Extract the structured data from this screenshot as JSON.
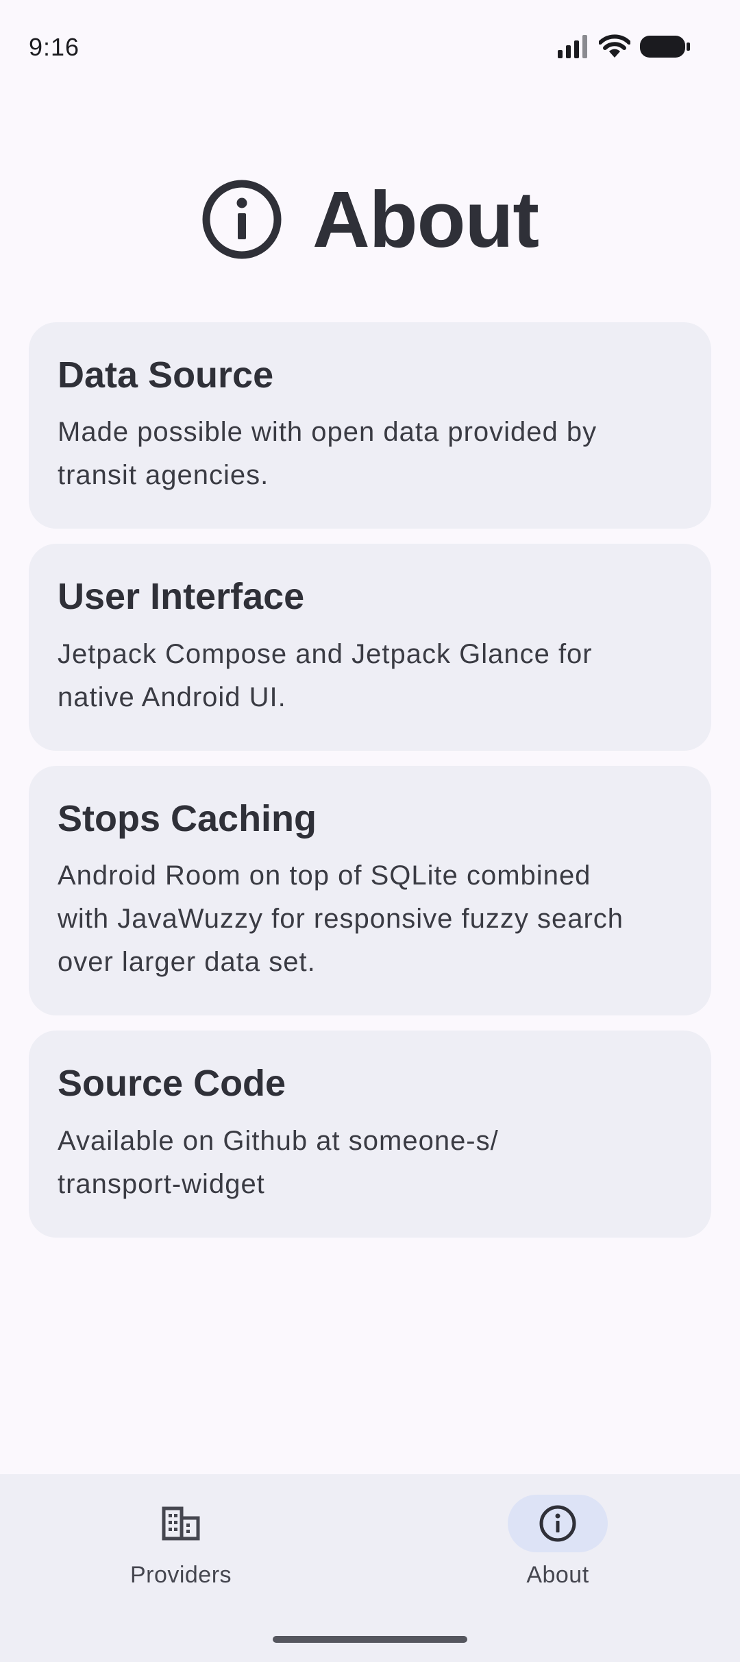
{
  "status_bar": {
    "time": "9:16"
  },
  "header": {
    "title": "About",
    "icon": "info-icon"
  },
  "cards": [
    {
      "title": "Data Source",
      "lines": [
        "Made possible with open data provided by",
        "transit agencies."
      ]
    },
    {
      "title": "User Interface",
      "lines": [
        "Jetpack Compose and Jetpack Glance for",
        "native Android UI."
      ]
    },
    {
      "title": "Stops Caching",
      "lines": [
        "Android Room on top of SQLite combined",
        "with JavaWuzzy for responsive fuzzy search",
        "over larger data set."
      ]
    },
    {
      "title": "Source Code",
      "lines": [
        "Available on Github at someone-s/",
        "transport-widget"
      ]
    }
  ],
  "bottom_nav": {
    "items": [
      {
        "label": "Providers",
        "icon": "building-icon",
        "active": false
      },
      {
        "label": "About",
        "icon": "info-icon",
        "active": true
      }
    ]
  },
  "colors": {
    "background": "#fbf8fd",
    "card": "#eeeef5",
    "active_indicator": "#dde3f6",
    "text": "#2f3038"
  }
}
